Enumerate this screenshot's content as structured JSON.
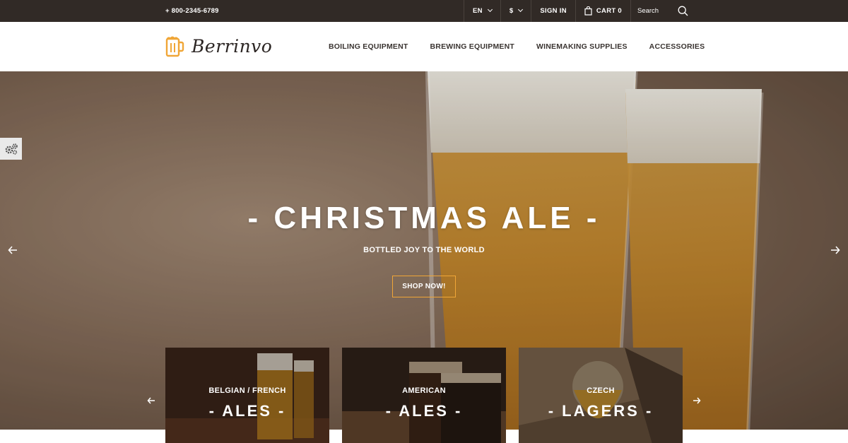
{
  "topbar": {
    "phone": "+ 800-2345-6789",
    "language": "EN",
    "currency": "$",
    "sign_in": "SIGN IN",
    "cart": "CART 0",
    "search_placeholder": "Search"
  },
  "header": {
    "brand": "Berrinvo",
    "nav": [
      "BOILING EQUIPMENT",
      "BREWING EQUIPMENT",
      "WINEMAKING SUPPLIES",
      "ACCESSORIES"
    ]
  },
  "hero": {
    "title": "- CHRISTMAS ALE -",
    "subtitle": "BOTTLED JOY TO THE WORLD",
    "button": "SHOP NOW!"
  },
  "cards": [
    {
      "caption": "BELGIAN / FRENCH",
      "title": "- ALES -"
    },
    {
      "caption": "AMERICAN",
      "title": "- ALES -"
    },
    {
      "caption": "CZECH",
      "title": "- LAGERS -"
    }
  ],
  "icons": {
    "logo": "beer-mug-icon",
    "cart": "shopping-bag-icon",
    "search": "search-icon",
    "settings": "gears-icon",
    "arrows": [
      "arrow-left-icon",
      "arrow-right-icon"
    ]
  },
  "colors": {
    "topbar_bg": "#312a26",
    "accent": "#f0a637",
    "text_dark": "#3a3431"
  }
}
